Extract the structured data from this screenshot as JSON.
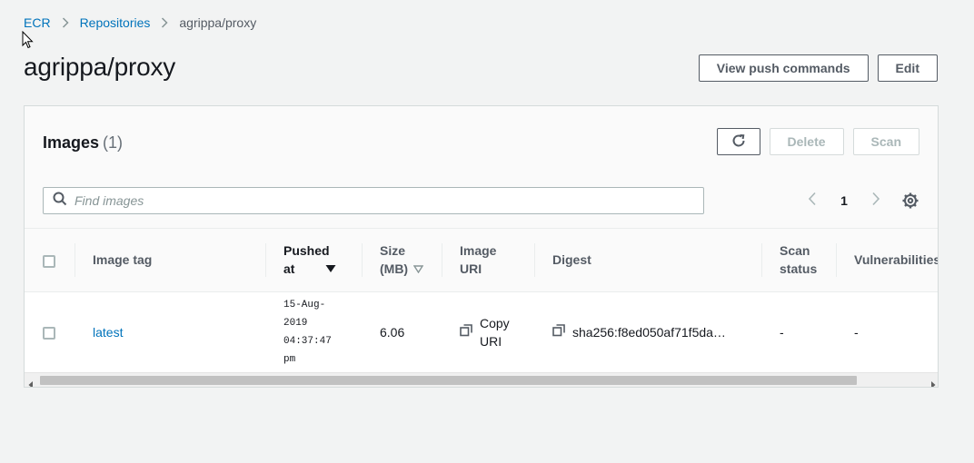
{
  "breadcrumb": {
    "items": [
      "ECR",
      "Repositories",
      "agrippa/proxy"
    ]
  },
  "header": {
    "title": "agrippa/proxy",
    "view_push_label": "View push commands",
    "edit_label": "Edit"
  },
  "images": {
    "title": "Images",
    "count": "(1)",
    "delete_label": "Delete",
    "scan_label": "Scan",
    "search_placeholder": "Find images",
    "page": "1",
    "columns": {
      "image_tag": "Image tag",
      "pushed_at_1": "Pushed",
      "pushed_at_2": "at",
      "size_1": "Size",
      "size_2": "(MB)",
      "image_uri_1": "Image",
      "image_uri_2": "URI",
      "digest": "Digest",
      "scan_status_1": "Scan",
      "scan_status_2": "status",
      "vulnerabilities": "Vulnerabilities"
    },
    "rows": [
      {
        "tag": "latest",
        "pushed_at": [
          "15-Aug-",
          "2019",
          "04:37:47",
          "pm"
        ],
        "size": "6.06",
        "uri_label_1": "Copy",
        "uri_label_2": "URI",
        "digest": "sha256:f8ed050af71f5da…",
        "scan_status": "-",
        "vulnerabilities": "-"
      }
    ]
  },
  "colors": {
    "link": "#0073bb",
    "text": "#16191f",
    "muted": "#545b64",
    "background": "#f2f3f3"
  },
  "icons": {
    "breadcrumb_separator": "chevron-right-icon",
    "refresh": "refresh-icon",
    "search": "search-icon",
    "prev": "chevron-left-icon",
    "next": "chevron-right-icon",
    "settings": "gear-icon",
    "copy": "copy-icon",
    "sort_desc": "caret-down-icon",
    "sort_unsorted": "caret-down-outline-icon"
  }
}
